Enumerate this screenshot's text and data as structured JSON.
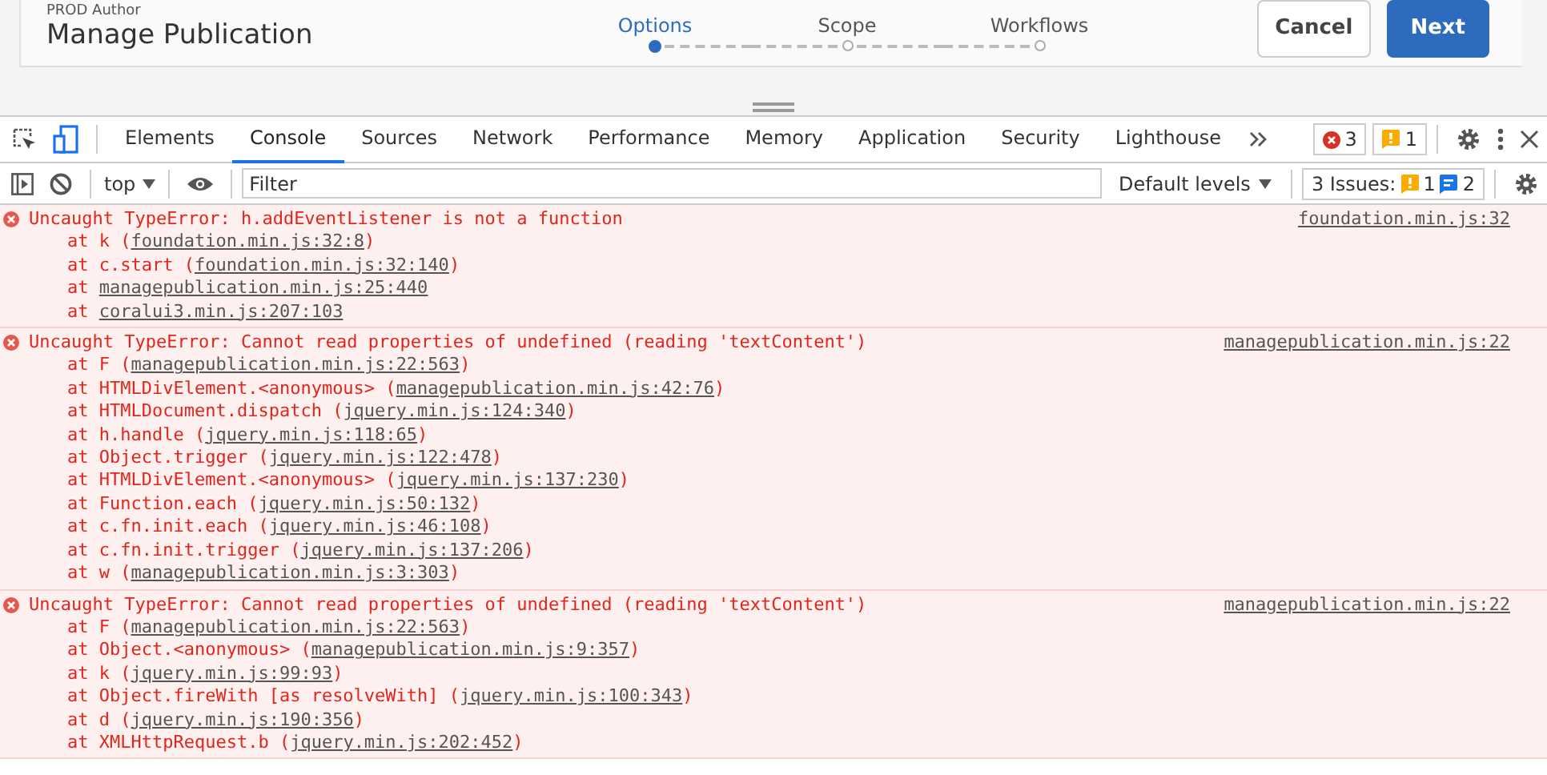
{
  "page": {
    "app_label": "PROD Author",
    "title": "Manage Publication",
    "steps": [
      {
        "label": "Options",
        "selected": true
      },
      {
        "label": "Scope",
        "selected": false
      },
      {
        "label": "Workflows",
        "selected": false
      }
    ],
    "buttons": [
      {
        "label": "Cancel",
        "kind": "secondary"
      },
      {
        "label": "Next",
        "kind": "primary"
      }
    ]
  },
  "devtools": {
    "tabs": [
      {
        "label": "Elements",
        "selected": false
      },
      {
        "label": "Console",
        "selected": true
      },
      {
        "label": "Sources",
        "selected": false
      },
      {
        "label": "Network",
        "selected": false
      },
      {
        "label": "Performance",
        "selected": false
      },
      {
        "label": "Memory",
        "selected": false
      },
      {
        "label": "Application",
        "selected": false
      },
      {
        "label": "Security",
        "selected": false
      },
      {
        "label": "Lighthouse",
        "selected": false
      }
    ],
    "error_count": "3",
    "warning_count": "1"
  },
  "console_toolbar": {
    "context": "top",
    "filter_placeholder": "Filter",
    "levels": "Default levels",
    "issues_label": "3 Issues:",
    "issue_warnings": "1",
    "issue_infos": "2"
  },
  "messages": [
    {
      "message": "Uncaught TypeError: h.addEventListener is not a function",
      "source": "foundation.min.js:32",
      "frames": [
        {
          "prefix": "at k (",
          "location": "foundation.min.js:32:8",
          "suffix": ")"
        },
        {
          "prefix": "at c.start (",
          "location": "foundation.min.js:32:140",
          "suffix": ")"
        },
        {
          "prefix": "at ",
          "location": "managepublication.min.js:25:440"
        },
        {
          "prefix": "at ",
          "location": "coralui3.min.js:207:103"
        }
      ]
    },
    {
      "message": "Uncaught TypeError: Cannot read properties of undefined (reading 'textContent')",
      "source": "managepublication.min.js:22",
      "frames": [
        {
          "prefix": "at F (",
          "location": "managepublication.min.js:22:563",
          "suffix": ")"
        },
        {
          "prefix": "at HTMLDivElement.<anonymous> (",
          "location": "managepublication.min.js:42:76",
          "suffix": ")"
        },
        {
          "prefix": "at HTMLDocument.dispatch (",
          "location": "jquery.min.js:124:340",
          "suffix": ")"
        },
        {
          "prefix": "at h.handle (",
          "location": "jquery.min.js:118:65",
          "suffix": ")"
        },
        {
          "prefix": "at Object.trigger (",
          "location": "jquery.min.js:122:478",
          "suffix": ")"
        },
        {
          "prefix": "at HTMLDivElement.<anonymous> (",
          "location": "jquery.min.js:137:230",
          "suffix": ")"
        },
        {
          "prefix": "at Function.each (",
          "location": "jquery.min.js:50:132",
          "suffix": ")"
        },
        {
          "prefix": "at c.fn.init.each (",
          "location": "jquery.min.js:46:108",
          "suffix": ")"
        },
        {
          "prefix": "at c.fn.init.trigger (",
          "location": "jquery.min.js:137:206",
          "suffix": ")"
        },
        {
          "prefix": "at w (",
          "location": "managepublication.min.js:3:303",
          "suffix": ")"
        }
      ]
    },
    {
      "message": "Uncaught TypeError: Cannot read properties of undefined (reading 'textContent')",
      "source": "managepublication.min.js:22",
      "frames": [
        {
          "prefix": "at F (",
          "location": "managepublication.min.js:22:563",
          "suffix": ")"
        },
        {
          "prefix": "at Object.<anonymous> (",
          "location": "managepublication.min.js:9:357",
          "suffix": ")"
        },
        {
          "prefix": "at k (",
          "location": "jquery.min.js:99:93",
          "suffix": ")"
        },
        {
          "prefix": "at Object.fireWith [as resolveWith] (",
          "location": "jquery.min.js:100:343",
          "suffix": ")"
        },
        {
          "prefix": "at d (",
          "location": "jquery.min.js:190:356",
          "suffix": ")"
        },
        {
          "prefix": "at XMLHttpRequest.b (",
          "location": "jquery.min.js:202:452",
          "suffix": ")"
        }
      ]
    }
  ]
}
